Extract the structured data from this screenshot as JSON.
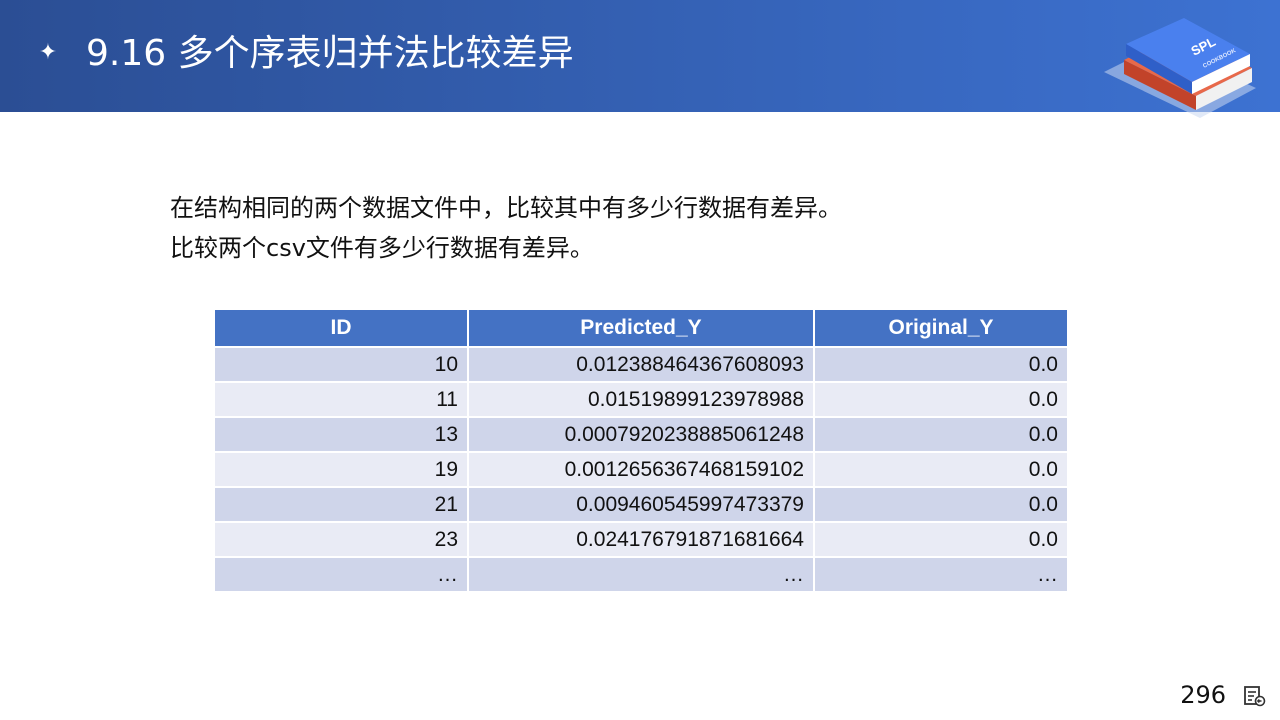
{
  "header": {
    "title": "9.16 多个序表归并法比较差异",
    "logo_text": "SPL",
    "logo_subtext": "COOKBOOK",
    "colors": {
      "header_start": "#2b4e94",
      "header_end": "#3d72d2",
      "book_blue": "#3f6fe0",
      "book_red": "#d9553a"
    }
  },
  "intro": {
    "line1": "在结构相同的两个数据文件中，比较其中有多少行数据有差异。",
    "line2": "比较两个csv文件有多少行数据有差异。"
  },
  "table": {
    "headers": [
      "ID",
      "Predicted_Y",
      "Original_Y"
    ],
    "rows": [
      [
        "10",
        "0.012388464367608093",
        "0.0"
      ],
      [
        "11",
        "0.01519899123978988",
        "0.0"
      ],
      [
        "13",
        "0.0007920238885061248",
        "0.0"
      ],
      [
        "19",
        "0.0012656367468159102",
        "0.0"
      ],
      [
        "21",
        "0.009460545997473379",
        "0.0"
      ],
      [
        "23",
        "0.024176791871681664",
        "0.0"
      ],
      [
        "…",
        "…",
        "…"
      ]
    ],
    "colors": {
      "header_bg": "#4472c4",
      "row_odd": "#cfd5ea",
      "row_even": "#e9ebf5"
    }
  },
  "footer": {
    "page_number": "296",
    "icon": "notes-icon"
  }
}
